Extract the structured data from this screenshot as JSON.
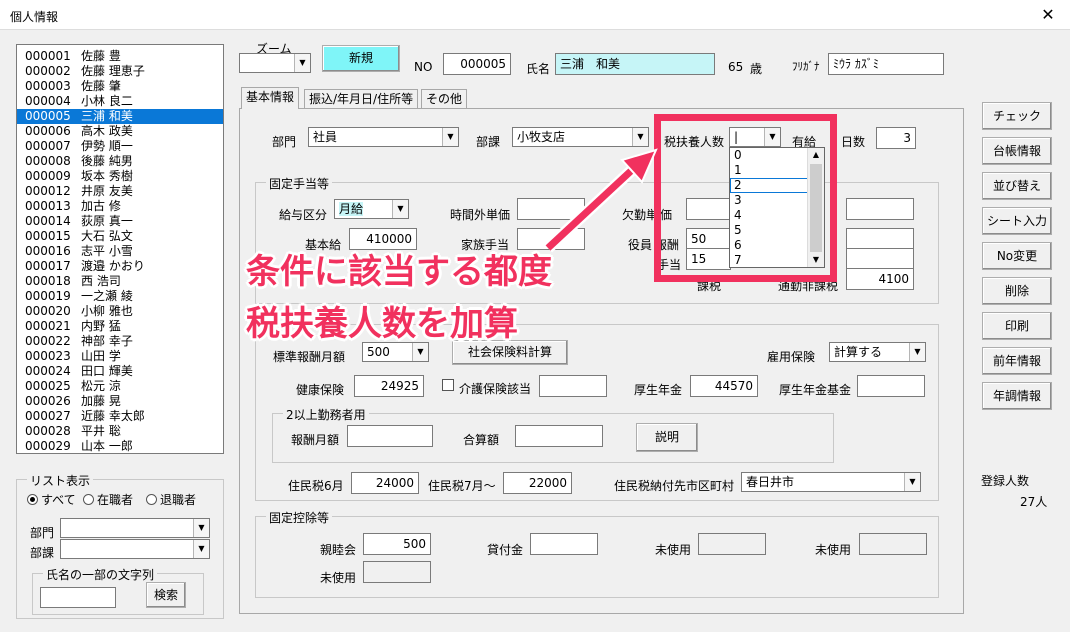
{
  "window": {
    "title": "個人情報",
    "close": "✕"
  },
  "employees": [
    {
      "no": "000001",
      "name": "佐藤 豊"
    },
    {
      "no": "000002",
      "name": "佐藤 理恵子"
    },
    {
      "no": "000003",
      "name": "佐藤 肇"
    },
    {
      "no": "000004",
      "name": "小林 良二"
    },
    {
      "no": "000005",
      "name": "三浦 和美"
    },
    {
      "no": "000006",
      "name": "高木 政美"
    },
    {
      "no": "000007",
      "name": "伊勢 順一"
    },
    {
      "no": "000008",
      "name": "後藤 純男"
    },
    {
      "no": "000009",
      "name": "坂本 秀樹"
    },
    {
      "no": "000012",
      "name": "井原 友美"
    },
    {
      "no": "000013",
      "name": "加古 修"
    },
    {
      "no": "000014",
      "name": "荻原 真一"
    },
    {
      "no": "000015",
      "name": "大石 弘文"
    },
    {
      "no": "000016",
      "name": "志平 小雪"
    },
    {
      "no": "000017",
      "name": "渡邉 かおり"
    },
    {
      "no": "000018",
      "name": "西 浩司"
    },
    {
      "no": "000019",
      "name": "一之瀬 綾"
    },
    {
      "no": "000020",
      "name": "小柳 雅也"
    },
    {
      "no": "000021",
      "name": "内野 猛"
    },
    {
      "no": "000022",
      "name": "神部 幸子"
    },
    {
      "no": "000023",
      "name": "山田 学"
    },
    {
      "no": "000024",
      "name": "田口 輝美"
    },
    {
      "no": "000025",
      "name": "松元 涼"
    },
    {
      "no": "000026",
      "name": "加藤 晃"
    },
    {
      "no": "000027",
      "name": "近藤 幸太郎"
    },
    {
      "no": "000028",
      "name": "平井 聡"
    },
    {
      "no": "000029",
      "name": "山本 一郎"
    }
  ],
  "selected_index": 4,
  "list_filter": {
    "legend": "リスト表示",
    "radio_all": "すべて",
    "radio_active": "在職者",
    "radio_retired": "退職者",
    "dept_label": "部門",
    "section_label": "部課",
    "name_search_legend": "氏名の一部の文字列",
    "search_button": "検索"
  },
  "header": {
    "zoom_label": "ズーム",
    "new_button": "新規",
    "no_label": "NO",
    "no_value": "000005",
    "name_label": "氏名",
    "name_value": "三浦　和美",
    "age_value": "65",
    "age_unit": "歳",
    "kana_label": "ﾌﾘｶﾞﾅ",
    "kana_value": "ﾐｳﾗ ｶｽﾞﾐ"
  },
  "tabs": [
    "基本情報",
    "振込/年月日/住所等",
    "その他"
  ],
  "basic": {
    "dept_label": "部門",
    "dept_value": "社員",
    "section_label": "部課",
    "section_value": "小牧支店",
    "dependents_label": "税扶養人数",
    "dependents_value": "|",
    "paid_leave_label": "有給",
    "paid_leave_label2": "日数",
    "paid_leave_value": "3"
  },
  "dependents_dropdown": {
    "options": [
      "0",
      "1",
      "2",
      "3",
      "4",
      "5",
      "6",
      "7"
    ],
    "selected": "2",
    "cut_off": "100"
  },
  "fixed_allowance": {
    "legend": "固定手当等",
    "pay_type_label": "給与区分",
    "pay_type_value": "月給",
    "overtime_label": "時間外単価",
    "absence_label": "欠勤単",
    "absence_label_tail": "価",
    "base_salary_label": "基本給",
    "base_salary_value": "410000",
    "family_label": "家族手当",
    "officer_label": "役員",
    "officer_label_tail": "報酬",
    "officer_value": "50",
    "allowance_value": "15",
    "allowance_label_tail": "手当",
    "taxable_commute_label": "課税",
    "nontaxable_commute_label": "通勤非課税",
    "nontaxable_commute_value": "4100"
  },
  "insurance": {
    "standard_label": "標準報酬月額",
    "standard_value": "500",
    "calc_button": "社会保険料計算",
    "employment_ins_label": "雇用保険",
    "employment_ins_value": "計算する",
    "health_label": "健康保険",
    "health_value": "24925",
    "care_label": "介護保険該当",
    "pension_label": "厚生年金",
    "pension_value": "44570",
    "pension_fund_label": "厚生年金基金",
    "multi_legend": "2以上勤務者用",
    "remuneration_label": "報酬月額",
    "total_label": "合算額",
    "explain_button": "説明",
    "resident_jun_label": "住民税6月",
    "resident_jun_value": "24000",
    "resident_jul_label": "住民税7月～",
    "resident_jul_value": "22000",
    "resident_city_label": "住民税納付先市区町村",
    "resident_city_value": "春日井市"
  },
  "fixed_deduction": {
    "legend": "固定控除等",
    "social_label": "親睦会",
    "social_value": "500",
    "loan_label": "貸付金",
    "unused1_label": "未使用",
    "unused2_label": "未使用",
    "unused3_label": "未使用"
  },
  "side_buttons": [
    "チェック",
    "台帳情報",
    "並び替え",
    "シート入力",
    "No変更",
    "削除",
    "印刷",
    "前年情報",
    "年調情報"
  ],
  "registered": {
    "label": "登録人数",
    "value": "27人"
  },
  "annotation": {
    "line1": "条件に該当する都度",
    "line2": "税扶養人数を加算"
  },
  "colors": {
    "annotation": "#f1315e",
    "selection": "#0a78d7",
    "highlight_field": "#c6f5f7"
  }
}
